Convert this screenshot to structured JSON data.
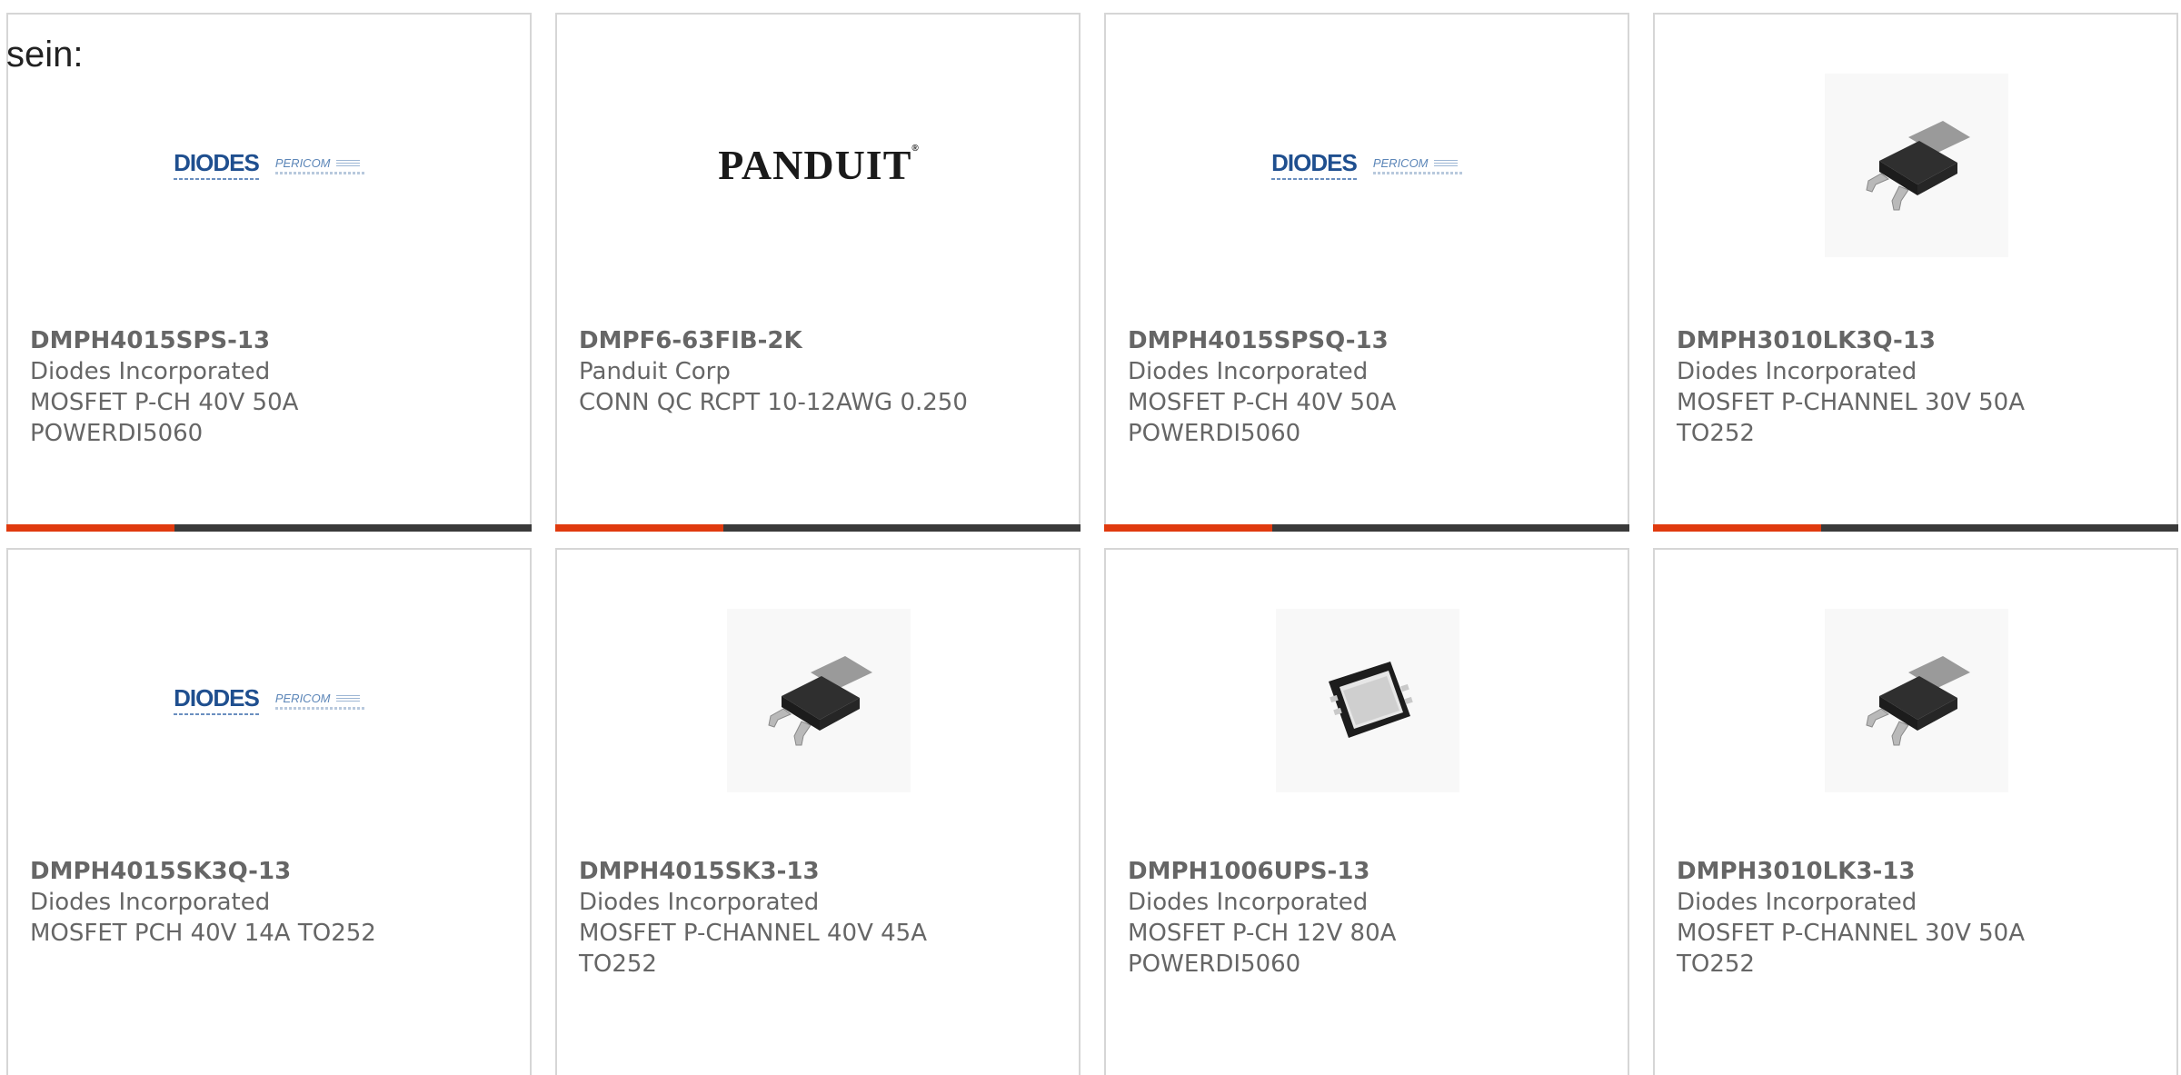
{
  "intro_text": "sein:",
  "colors": {
    "card_border": "#d6d6d6",
    "text": "#666666",
    "bar_dark": "#3a3a3a",
    "bar_accent": "#e03a0e",
    "diodes_blue": "#1f4f8f"
  },
  "cards": [
    {
      "part": "DMPH4015SPS-13",
      "manufacturer": "Diodes Incorporated",
      "description_1": "MOSFET P-CH 40V 50A",
      "description_2": "POWERDI5060",
      "image": "diodes-pericom-logo",
      "logo_text": "DIODES",
      "logo_sub": "PERICOM"
    },
    {
      "part": "DMPF6-63FIB-2K",
      "manufacturer": "Panduit Corp",
      "description_1": "CONN QC RCPT 10-12AWG 0.250",
      "description_2": "",
      "image": "panduit-logo",
      "logo_text": "PANDUIT"
    },
    {
      "part": "DMPH4015SPSQ-13",
      "manufacturer": "Diodes Incorporated",
      "description_1": "MOSFET P-CH 40V 50A",
      "description_2": "POWERDI5060",
      "image": "diodes-pericom-logo",
      "logo_text": "DIODES",
      "logo_sub": "PERICOM"
    },
    {
      "part": "DMPH3010LK3Q-13",
      "manufacturer": "Diodes Incorporated",
      "description_1": "MOSFET P-CHANNEL 30V 50A",
      "description_2": "TO252",
      "image": "to252-package-photo"
    },
    {
      "part": "DMPH4015SK3Q-13",
      "manufacturer": "Diodes Incorporated",
      "description_1": "MOSFET PCH 40V 14A TO252",
      "description_2": "",
      "image": "diodes-pericom-logo",
      "logo_text": "DIODES",
      "logo_sub": "PERICOM"
    },
    {
      "part": "DMPH4015SK3-13",
      "manufacturer": "Diodes Incorporated",
      "description_1": "MOSFET P-CHANNEL 40V 45A",
      "description_2": "TO252",
      "image": "to252-package-photo"
    },
    {
      "part": "DMPH1006UPS-13",
      "manufacturer": "Diodes Incorporated",
      "description_1": "MOSFET P-CH 12V 80A",
      "description_2": "POWERDI5060",
      "image": "powerdi5060-package-photo"
    },
    {
      "part": "DMPH3010LK3-13",
      "manufacturer": "Diodes Incorporated",
      "description_1": "MOSFET P-CHANNEL 30V 50A",
      "description_2": "TO252",
      "image": "to252-package-photo"
    }
  ]
}
